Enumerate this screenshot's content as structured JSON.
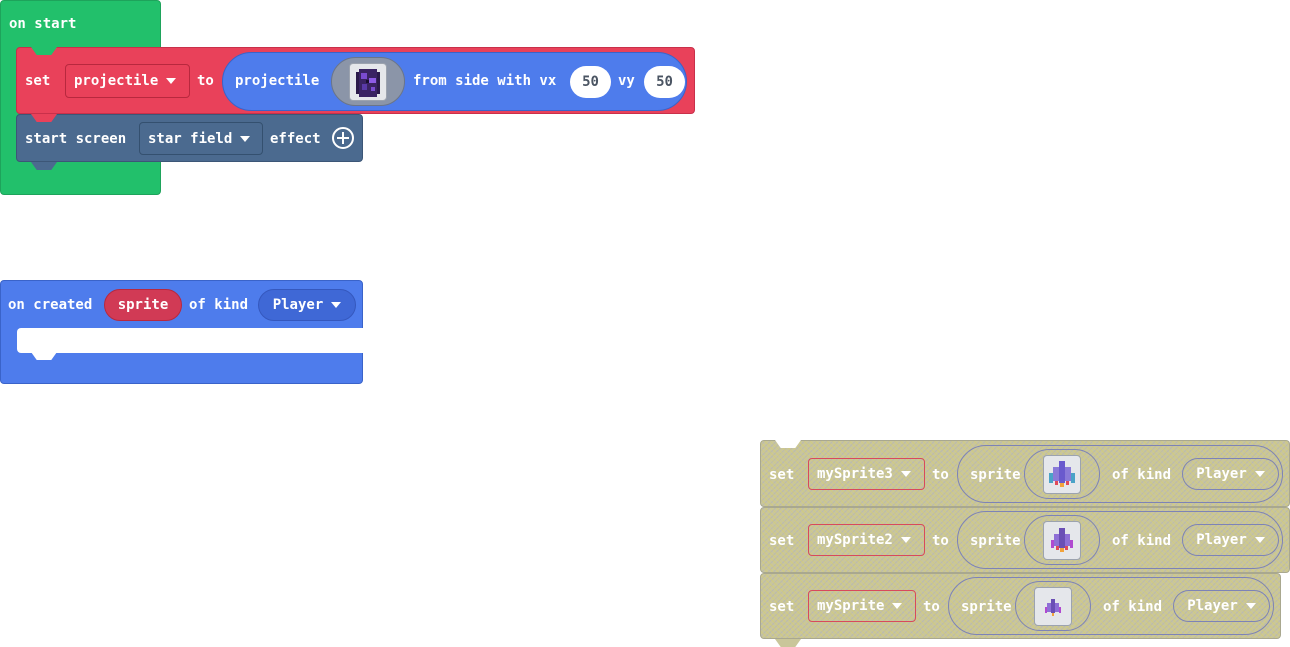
{
  "colors": {
    "events_green": "#22c06b",
    "variables_red": "#e9415a",
    "sprites_blue": "#4e7cec",
    "scene_slate": "#4b6a8f",
    "disabled_olive": "#c9c69a"
  },
  "on_start": {
    "hat_label": "on start",
    "set_block": {
      "set_label": "set",
      "variable": "projectile",
      "to_label": "to",
      "projectile_label": "projectile",
      "from_side_label": "from side with vx",
      "vx": "50",
      "vy_label": "vy",
      "vy": "50"
    },
    "screen_block": {
      "label": "start screen",
      "effect": "star field",
      "effect_label": "effect"
    }
  },
  "on_created": {
    "label": "on created",
    "param": "sprite",
    "of_kind_label": "of kind",
    "kind": "Player"
  },
  "disabled_blocks": [
    {
      "set_label": "set",
      "variable": "mySprite3",
      "to_label": "to",
      "sprite_label": "sprite",
      "of_kind_label": "of kind",
      "kind": "Player"
    },
    {
      "set_label": "set",
      "variable": "mySprite2",
      "to_label": "to",
      "sprite_label": "sprite",
      "of_kind_label": "of kind",
      "kind": "Player"
    },
    {
      "set_label": "set",
      "variable": "mySprite",
      "to_label": "to",
      "sprite_label": "sprite",
      "of_kind_label": "of kind",
      "kind": "Player"
    }
  ]
}
